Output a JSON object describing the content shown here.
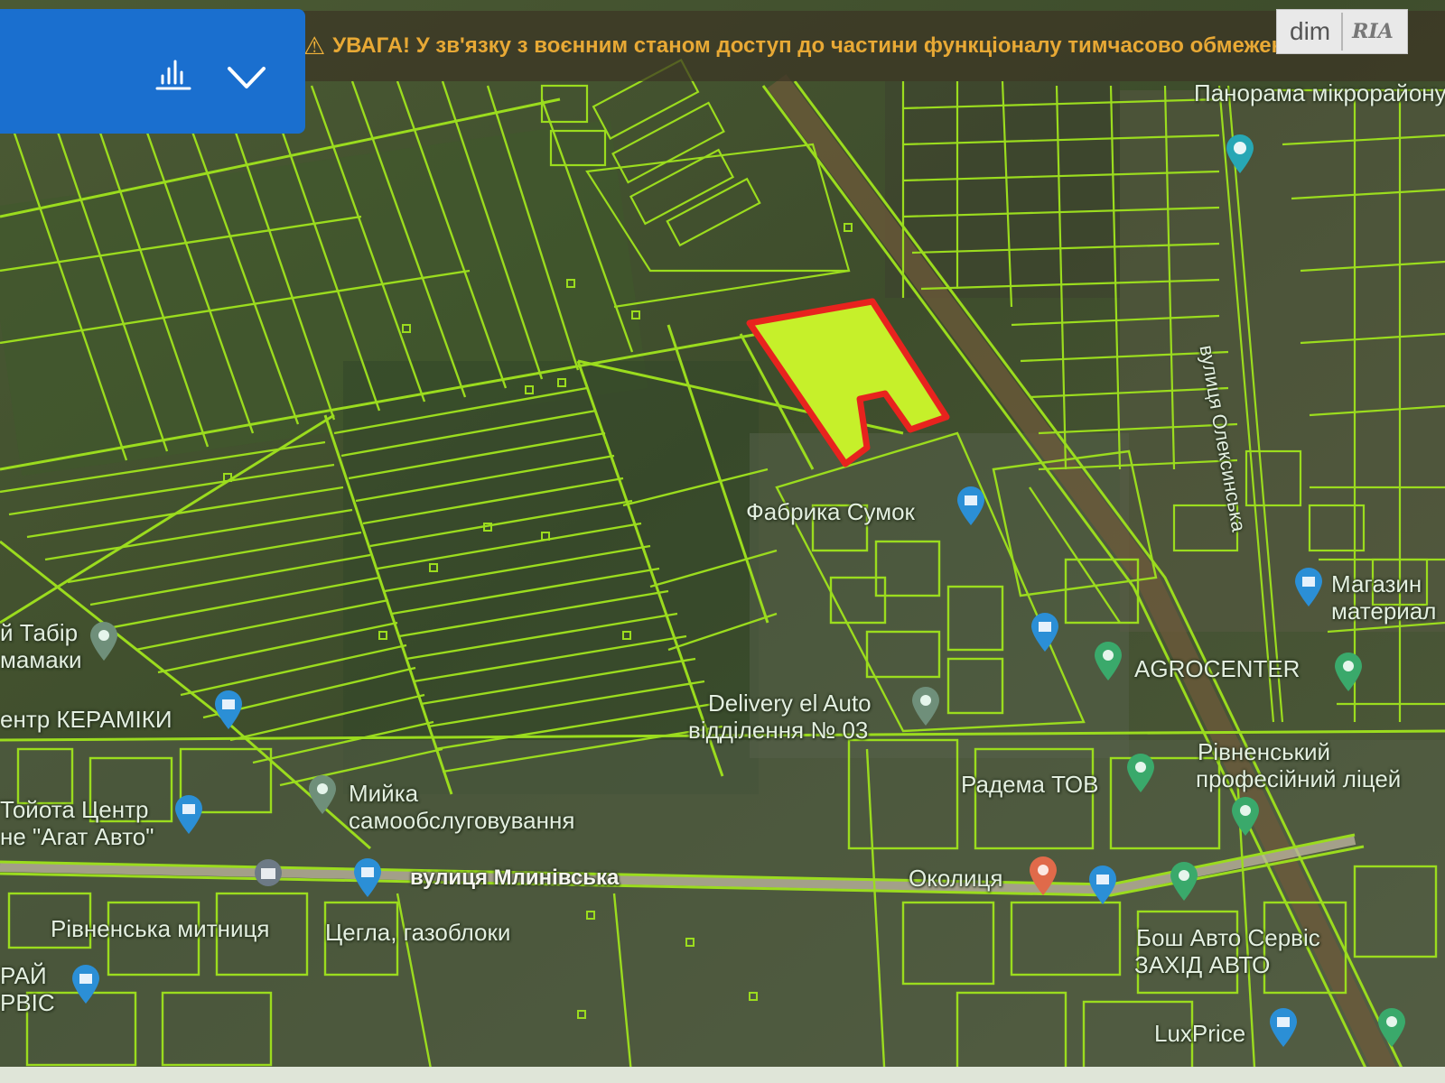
{
  "banner": {
    "icon": "warning-triangle-icon",
    "text": "УВАГА! У зв'язку з воєнним станом доступ до частини функціоналу тимчасово обмежено"
  },
  "panel": {
    "chart_icon": "bar-chart-icon",
    "chevron_icon": "chevron-down-icon"
  },
  "logo": {
    "dim": "dim",
    "ria": "RIA"
  },
  "colors": {
    "parcel_outline": "#9bdc1e",
    "selected_fill": "#c6f02a",
    "selected_outline": "#e8231e",
    "panel_blue": "#1a6fcf",
    "banner_text": "#e8a935"
  },
  "map_labels": {
    "panorama": "Панорама мікрорайону Північний",
    "oleksinska": "вулиця Олексинська",
    "fabryka": "Фабрика Сумок",
    "magazyn": "Магазин материал",
    "agrocenter": "AGROCENTER",
    "delivery1": "Delivery el Auto",
    "delivery2": "відділення № 03",
    "tabir": "й Табір",
    "mamaky": "мамаки",
    "keramiky": "ентр КЕРАМІКИ",
    "myika1": "Мийка",
    "myika2": "самообслуговування",
    "toyota1": "Тойота Центр",
    "toyota2": "не \"Агат Авто\"",
    "radema": "Радема ТОВ",
    "rivne_prof1": "Рівненський",
    "rivne_prof2": "професійний ліцей",
    "mlynivska": "вулиця Млинівська",
    "okolytsia": "Околиця",
    "mytnytsia": "Рівненська митниця",
    "tsehla": "Цегла, газоблоки",
    "bosh1": "Бош Авто Сервіс",
    "bosh2": "ЗАХІД АВТО",
    "rai1": "РАЙ",
    "rai2": "РВІС",
    "luxprice": "LuxPrice"
  }
}
